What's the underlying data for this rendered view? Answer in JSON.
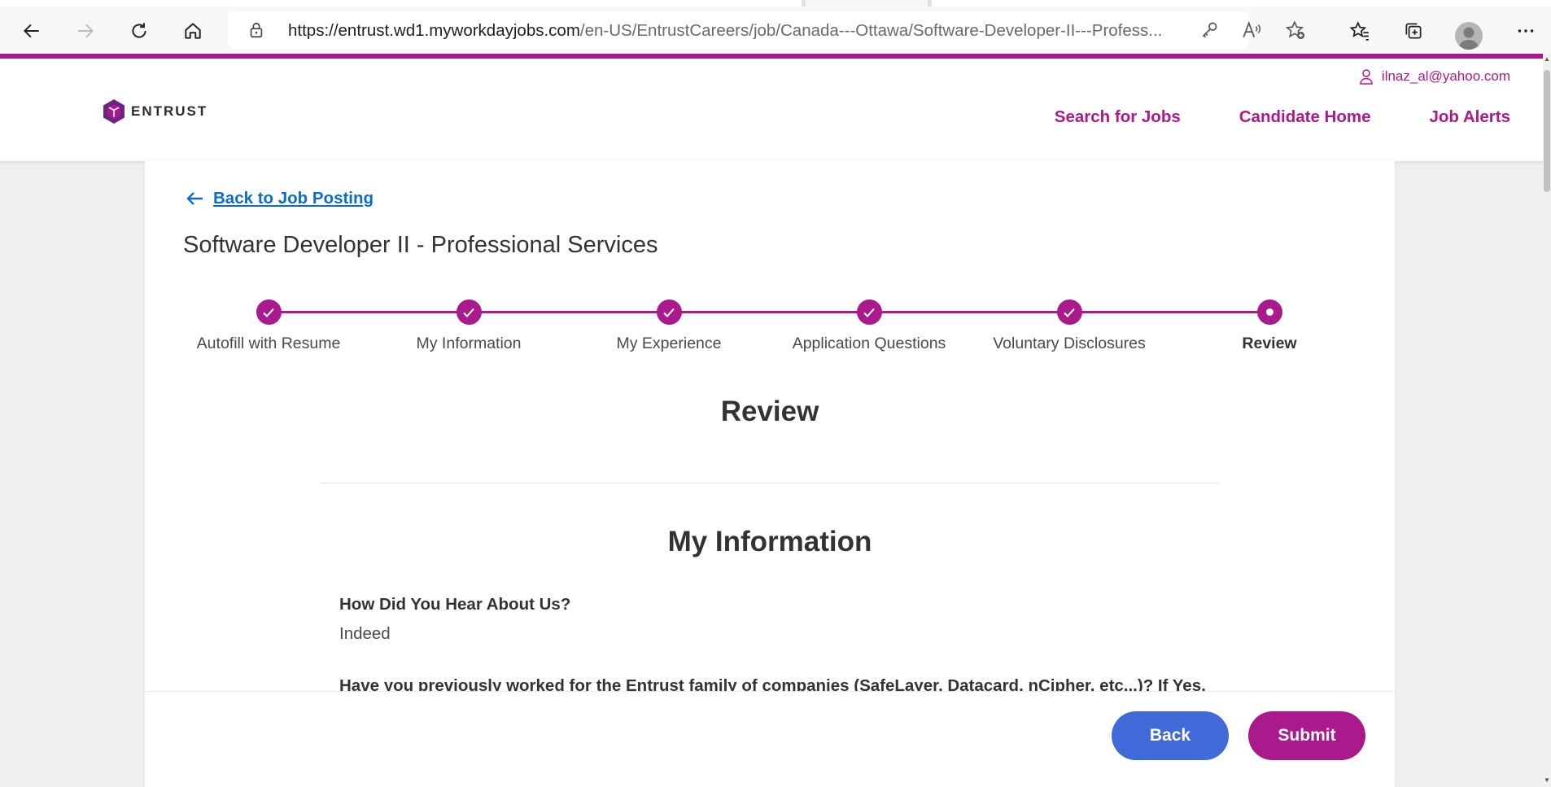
{
  "browser": {
    "url_host": "https://entrust.wd1.myworkdayjobs.com",
    "url_path": "/en-US/EntrustCareers/job/Canada---Ottawa/Software-Developer-II---Profess..."
  },
  "site": {
    "logo_text": "ENTRUST",
    "user_email": "ilnaz_al@yahoo.com",
    "nav": [
      "Search for Jobs",
      "Candidate Home",
      "Job Alerts"
    ],
    "brand_color": "#ab1a8c"
  },
  "page": {
    "back_link": "Back to Job Posting",
    "job_title": "Software Developer II - Professional Services",
    "steps": [
      {
        "label": "Autofill with Resume",
        "status": "complete"
      },
      {
        "label": "My Information",
        "status": "complete"
      },
      {
        "label": "My Experience",
        "status": "complete"
      },
      {
        "label": "Application Questions",
        "status": "complete"
      },
      {
        "label": "Voluntary Disclosures",
        "status": "complete"
      },
      {
        "label": "Review",
        "status": "current"
      }
    ],
    "heading": "Review",
    "section_title": "My Information",
    "questions": [
      {
        "label": "How Did You Hear About Us?",
        "answer": "Indeed"
      },
      {
        "label": "Have you previously worked for the Entrust family of companies (SafeLayer, Datacard, nCipher, etc...)? If Yes,",
        "answer": ""
      }
    ],
    "buttons": {
      "back": "Back",
      "submit": "Submit"
    }
  }
}
